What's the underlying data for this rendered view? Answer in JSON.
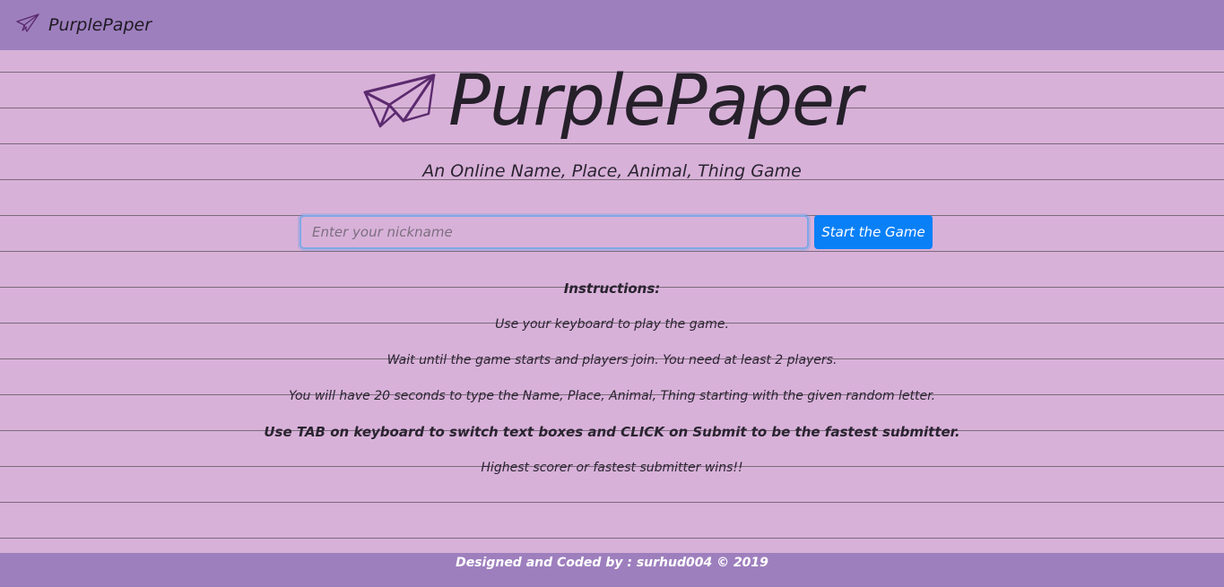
{
  "navbar": {
    "brand": "PurplePaper",
    "brand_icon": "paper-plane-icon"
  },
  "hero": {
    "title": "PurplePaper",
    "logo_icon": "paper-plane-icon",
    "subtitle": "An Online Name, Place, Animal, Thing Game"
  },
  "form": {
    "nickname_placeholder": "Enter your nickname",
    "nickname_value": "",
    "start_label": "Start the Game"
  },
  "instructions": {
    "heading": "Instructions:",
    "items": [
      "Use your keyboard to play the game.",
      "Wait until the game starts and players join. You need at least 2 players.",
      "You will have 20 seconds to type the Name, Place, Animal, Thing starting with the given random letter.",
      "Use TAB on keyboard to switch text boxes and CLICK on Submit to be the fastest submitter.",
      "Highest scorer or fastest submitter wins!!"
    ]
  },
  "footer": {
    "text": "Designed and Coded by : surhud004 © 2019"
  },
  "colors": {
    "navbar": "#9e7fbe",
    "page_background": "#d8b1d9",
    "button": "#0a80f6",
    "logo": "#5b2a6e"
  }
}
